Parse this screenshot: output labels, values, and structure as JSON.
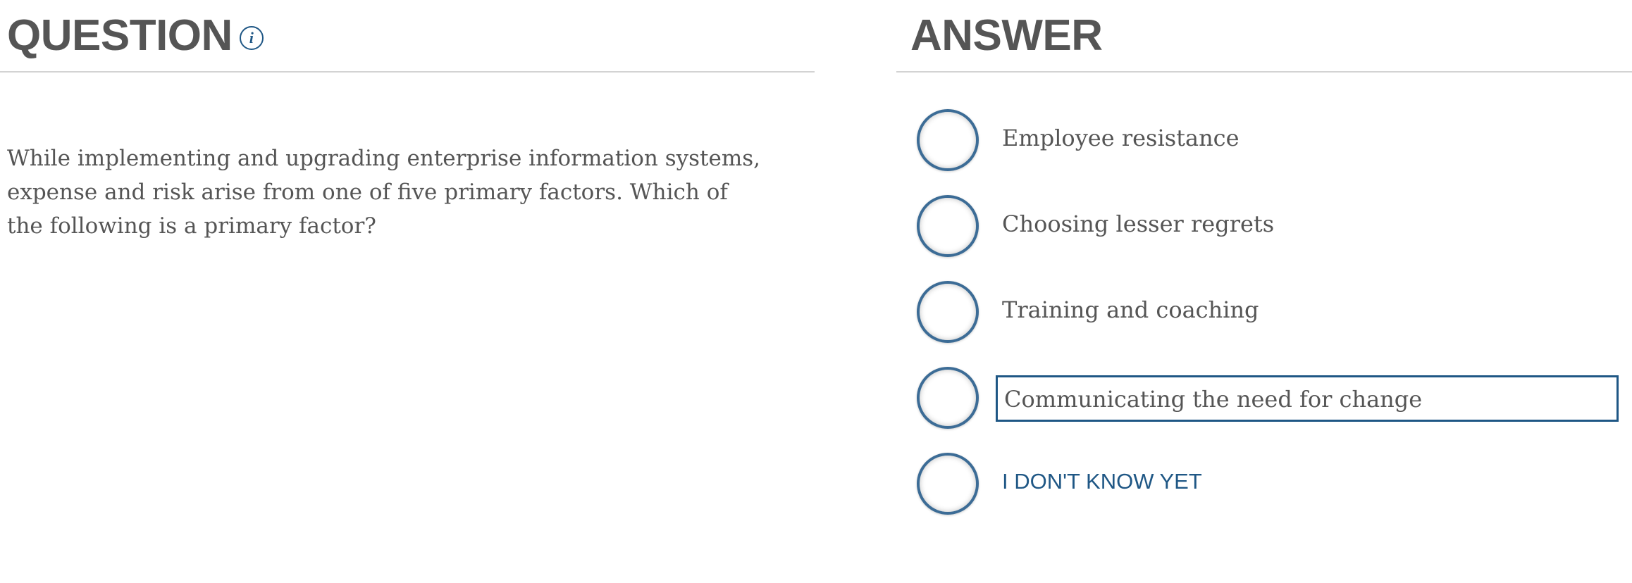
{
  "question": {
    "heading": "QUESTION",
    "info_icon": "info-icon",
    "text": "While implementing and upgrading enterprise information systems, expense and risk arise from one of five primary factors. Which of the following is a primary factor?"
  },
  "answer": {
    "heading": "ANSWER",
    "options": [
      {
        "label": "Employee resistance"
      },
      {
        "label": "Choosing lesser regrets"
      },
      {
        "label": "Training and coaching"
      },
      {
        "label": "Communicating the need for change"
      },
      {
        "label": "I DON'T KNOW YET"
      }
    ]
  },
  "colors": {
    "text": "#555555",
    "accent": "#1f5785",
    "radio_border": "#3c6c96",
    "divider": "#d3d3d3"
  }
}
